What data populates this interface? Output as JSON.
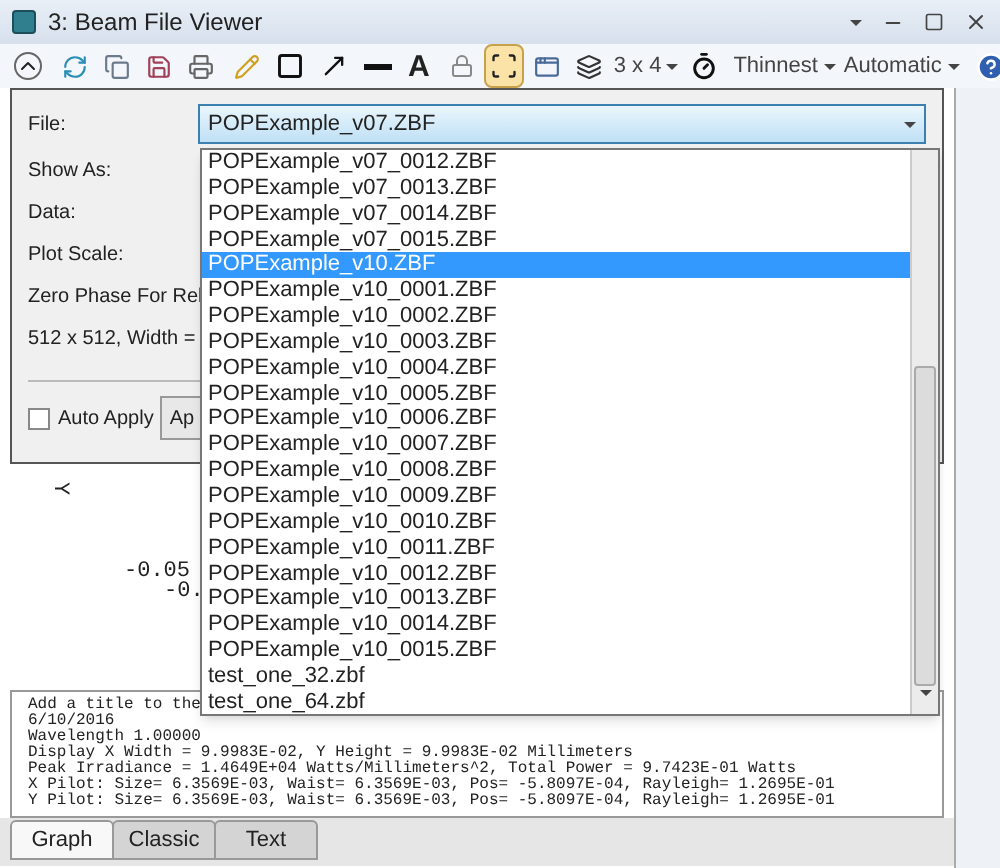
{
  "window": {
    "title": "3: Beam File Viewer"
  },
  "toolbar": {
    "text_tool": "A",
    "fit_selected": true,
    "layout_label": "3 x 4",
    "line_width": "Thinnest",
    "scale": "Automatic"
  },
  "settings": {
    "file_label": "File:",
    "file_value": "POPExample_v07.ZBF",
    "labels": [
      "Show As:",
      "Data:",
      "Plot Scale:",
      "Zero Phase For Rel"
    ],
    "info": "512 x 512, Width =",
    "auto_apply": {
      "label": "Auto Apply",
      "checked": false
    },
    "apply_button": "Ap"
  },
  "file_dropdown": {
    "items": [
      {
        "label": "POPExample_v07_0012.ZBF",
        "selected": false
      },
      {
        "label": "POPExample_v07_0013.ZBF",
        "selected": false
      },
      {
        "label": "POPExample_v07_0014.ZBF",
        "selected": false
      },
      {
        "label": "POPExample_v07_0015.ZBF",
        "selected": false
      },
      {
        "label": "POPExample_v10.ZBF",
        "selected": true
      },
      {
        "label": "POPExample_v10_0001.ZBF",
        "selected": false
      },
      {
        "label": "POPExample_v10_0002.ZBF",
        "selected": false
      },
      {
        "label": "POPExample_v10_0003.ZBF",
        "selected": false
      },
      {
        "label": "POPExample_v10_0004.ZBF",
        "selected": false
      },
      {
        "label": "POPExample_v10_0005.ZBF",
        "selected": false
      },
      {
        "label": "POPExample_v10_0006.ZBF",
        "selected": false
      },
      {
        "label": "POPExample_v10_0007.ZBF",
        "selected": false
      },
      {
        "label": "POPExample_v10_0008.ZBF",
        "selected": false
      },
      {
        "label": "POPExample_v10_0009.ZBF",
        "selected": false
      },
      {
        "label": "POPExample_v10_0010.ZBF",
        "selected": false
      },
      {
        "label": "POPExample_v10_0011.ZBF",
        "selected": false
      },
      {
        "label": "POPExample_v10_0012.ZBF",
        "selected": false
      },
      {
        "label": "POPExample_v10_0013.ZBF",
        "selected": false
      },
      {
        "label": "POPExample_v10_0014.ZBF",
        "selected": false
      },
      {
        "label": "POPExample_v10_0015.ZBF",
        "selected": false
      },
      {
        "label": "test_one_32.zbf",
        "selected": false
      },
      {
        "label": "test_one_64.zbf",
        "selected": false
      }
    ]
  },
  "plot": {
    "axis_label": "Y",
    "tick_labels": [
      "-0.05",
      "-0."
    ]
  },
  "text_output": {
    "lines": [
      "Add a title to the",
      "6/10/2016",
      "Wavelength 1.00000",
      "Display X Width = 9.9983E-02, Y Height = 9.9983E-02 Millimeters",
      "Peak Irradiance = 1.4649E+04 Watts/Millimeters^2, Total Power = 9.7423E-01 Watts",
      "X Pilot: Size= 6.3569E-03, Waist= 6.3569E-03, Pos= -5.8097E-04, Rayleigh= 1.2695E-01",
      "Y Pilot: Size= 6.3569E-03, Waist= 6.3569E-03, Pos= -5.8097E-04, Rayleigh= 1.2695E-01"
    ]
  },
  "tabs": [
    {
      "label": "Graph",
      "selected": true
    },
    {
      "label": "Classic",
      "selected": false
    },
    {
      "label": "Text",
      "selected": false
    }
  ]
}
